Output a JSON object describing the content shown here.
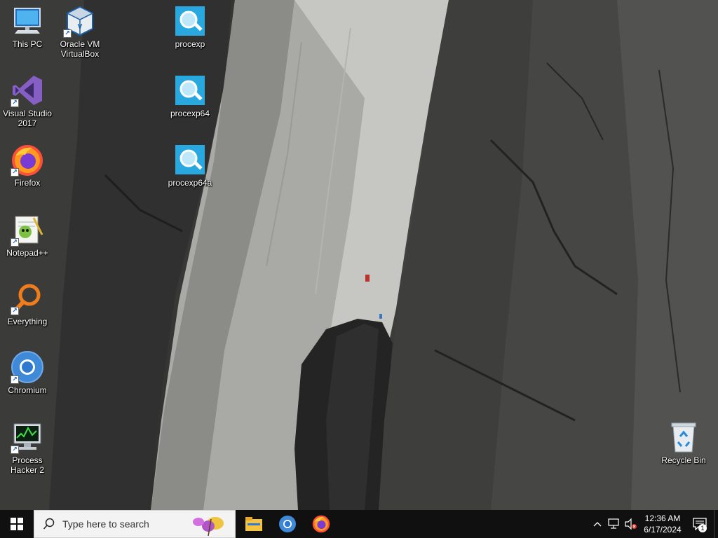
{
  "desktop": {
    "icons": [
      {
        "label": "This PC",
        "icon": "this-pc-icon"
      },
      {
        "label": "Oracle VM VirtualBox",
        "icon": "virtualbox-icon"
      },
      {
        "label": "procexp",
        "icon": "procexp-icon"
      },
      {
        "label": "Visual Studio 2017",
        "icon": "visual-studio-icon"
      },
      {
        "label": "procexp64",
        "icon": "procexp64-icon"
      },
      {
        "label": "Firefox",
        "icon": "firefox-icon"
      },
      {
        "label": "procexp64a",
        "icon": "procexp64a-icon"
      },
      {
        "label": "Notepad++",
        "icon": "notepad-plus-plus-icon"
      },
      {
        "label": "Everything",
        "icon": "everything-search-icon"
      },
      {
        "label": "Chromium",
        "icon": "chromium-icon"
      },
      {
        "label": "Process Hacker 2",
        "icon": "process-hacker-icon"
      },
      {
        "label": "Recycle Bin",
        "icon": "recycle-bin-icon"
      }
    ]
  },
  "taskbar": {
    "search_placeholder": "Type here to search",
    "pinned": [
      {
        "name": "File Explorer",
        "icon": "file-explorer-icon"
      },
      {
        "name": "Chromium",
        "icon": "chromium-icon"
      },
      {
        "name": "Firefox",
        "icon": "firefox-icon"
      }
    ],
    "clock": {
      "time": "12:36 AM",
      "date": "6/17/2024"
    },
    "notification_count": "1"
  },
  "colors": {
    "taskbar_bg": "#101010",
    "search_bg": "#f3f3f3",
    "procexp_blue": "#29a8e0",
    "windows_white": "#ffffff"
  }
}
